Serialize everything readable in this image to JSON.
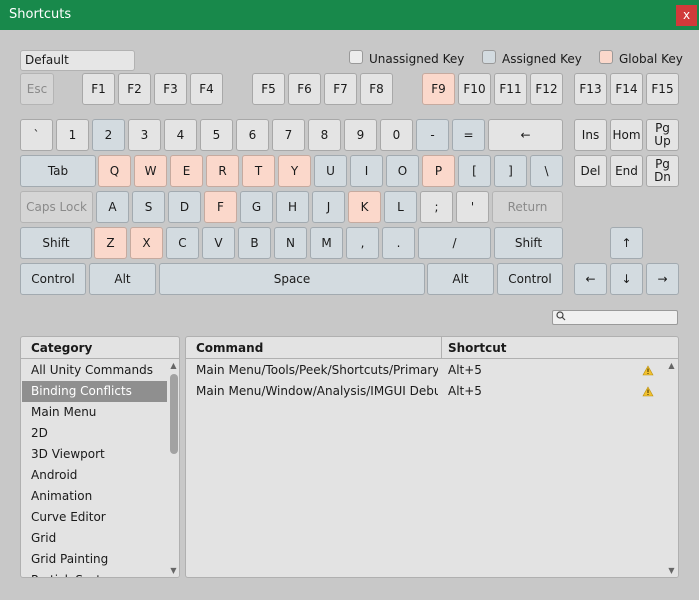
{
  "window": {
    "title": "Shortcuts",
    "close_label": "x"
  },
  "profile": {
    "value": "Default"
  },
  "legend": [
    {
      "label": "Unassigned Key",
      "color": "#e4e4e4"
    },
    {
      "label": "Assigned Key",
      "color": "#d3dbe0"
    },
    {
      "label": "Global Key",
      "color": "#fbd8cb"
    }
  ],
  "keys": {
    "esc": "Esc",
    "f1": "F1",
    "f2": "F2",
    "f3": "F3",
    "f4": "F4",
    "f5": "F5",
    "f6": "F6",
    "f7": "F7",
    "f8": "F8",
    "f9": "F9",
    "f10": "F10",
    "f11": "F11",
    "f12": "F12",
    "f13": "F13",
    "f14": "F14",
    "f15": "F15",
    "backtick": "`",
    "n1": "1",
    "n2": "2",
    "n3": "3",
    "n4": "4",
    "n5": "5",
    "n6": "6",
    "n7": "7",
    "n8": "8",
    "n9": "9",
    "n0": "0",
    "minus": "-",
    "equals": "=",
    "backspace": "←",
    "tab": "Tab",
    "q": "Q",
    "w": "W",
    "e": "E",
    "r": "R",
    "t": "T",
    "y": "Y",
    "u": "U",
    "i": "I",
    "o": "O",
    "p": "P",
    "lbracket": "[",
    "rbracket": "]",
    "backslash": "\\",
    "caps": "Caps Lock",
    "a": "A",
    "s": "S",
    "d": "D",
    "f": "F",
    "g": "G",
    "h": "H",
    "j": "J",
    "k": "K",
    "l": "L",
    "semicolon": ";",
    "quote": "'",
    "return": "Return",
    "lshift": "Shift",
    "z": "Z",
    "x": "X",
    "c": "C",
    "v": "V",
    "b": "B",
    "n": "N",
    "m": "M",
    "comma": ",",
    "period": ".",
    "slash": "/",
    "rshift": "Shift",
    "lctrl": "Control",
    "lalt": "Alt",
    "space": "Space",
    "ralt": "Alt",
    "rctrl": "Control",
    "ins": "Ins",
    "home": "Hom",
    "pgup_1": "Pg",
    "pgup_2": "Up",
    "del": "Del",
    "end": "End",
    "pgdn_1": "Pg",
    "pgdn_2": "Dn",
    "up": "↑",
    "left": "←",
    "down": "↓",
    "right": "→"
  },
  "search": {
    "value": "",
    "icon": "search-icon"
  },
  "category": {
    "header": "Category",
    "items": [
      "All Unity Commands",
      "Binding Conflicts",
      "Main Menu",
      "2D",
      "3D Viewport",
      "Android",
      "Animation",
      "Curve Editor",
      "Grid",
      "Grid Painting",
      "ParticleSystem"
    ],
    "selected": "Binding Conflicts"
  },
  "commands": {
    "header_command": "Command",
    "header_shortcut": "Shortcut",
    "rows": [
      {
        "command": "Main Menu/Tools/Peek/Shortcuts/Primary Shortcut",
        "shortcut": "Alt+5",
        "warning": "warning-icon"
      },
      {
        "command": "Main Menu/Window/Analysis/IMGUI Debugger",
        "shortcut": "Alt+5",
        "warning": "warning-icon"
      }
    ]
  }
}
